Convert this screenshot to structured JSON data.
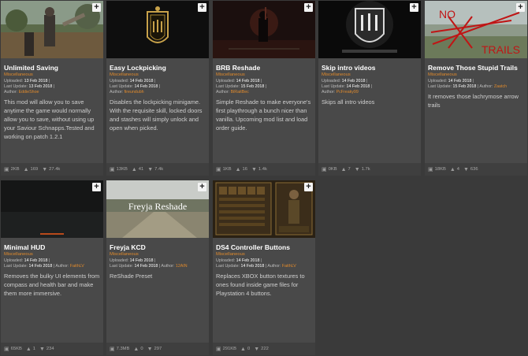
{
  "labels": {
    "uploaded": "Uploaded:",
    "last_update": "Last Update:",
    "author": "Author:",
    "add": "+"
  },
  "mods": [
    {
      "title": "Unlimited Saving",
      "category": "Miscellaneous",
      "uploaded": "13 Feb 2018",
      "last_update": "13 Feb 2018",
      "author": "EddieShoe",
      "description": "This mod will allow you to save anytime the game would normally allow you to save, without using up your Saviour Schnapps.Tested and working on patch 1.2.1",
      "size": "2KB",
      "endorsements": "169",
      "downloads": "27.4k"
    },
    {
      "title": "Easy Lockpicking",
      "category": "Miscellaneous",
      "uploaded": "14 Feb 2018",
      "last_update": "14 Feb 2018",
      "author": "fireundubh",
      "description": "Disables the lockpicking minigame. With the requisite skill, locked doors and stashes will simply unlock and open when picked.",
      "size": "13KB",
      "endorsements": "41",
      "downloads": "7.4k"
    },
    {
      "title": "BRB Reshade",
      "category": "Miscellaneous",
      "uploaded": "14 Feb 2018",
      "last_update": "15 Feb 2018",
      "author": "BiRaitBec",
      "description": "Simple Reshade to make everyone's first playthrough a bunch nicer than vanilla. Upcoming mod list and load order guide.",
      "size": "1KB",
      "endorsements": "16",
      "downloads": "1.4k"
    },
    {
      "title": "Skip intro videos",
      "category": "Miscellaneous",
      "uploaded": "14 Feb 2018",
      "last_update": "14 Feb 2018",
      "author": "PcFreaky99",
      "description": "Skips all intro videos",
      "size": "0KB",
      "endorsements": "7",
      "downloads": "1.7k"
    },
    {
      "title": "Remove Those Stupid Trails",
      "category": "Miscellaneous",
      "uploaded": "14 Feb 2018",
      "last_update": "15 Feb 2018",
      "author": "Zaatch",
      "description": "It removes those lachrymose arrow trails",
      "size": "18KB",
      "endorsements": "4",
      "downloads": "636"
    },
    {
      "title": "Minimal HUD",
      "category": "Miscellaneous",
      "uploaded": "14 Feb 2018",
      "last_update": "14 Feb 2018",
      "author": "FaithLV",
      "description": "Removes the bulky UI elements from compass and health bar and make them more immersive.",
      "size": "65KB",
      "endorsements": "1",
      "downloads": "234"
    },
    {
      "title": "Freyja KCD",
      "category": "Miscellaneous",
      "uploaded": "14 Feb 2018",
      "last_update": "14 Feb 2018",
      "author": "12AIN",
      "description": "ReShade Preset",
      "size": "7.3MB",
      "endorsements": "0",
      "downloads": "297"
    },
    {
      "title": "DS4 Controller Buttons",
      "category": "Miscellaneous",
      "uploaded": "14 Feb 2018",
      "last_update": "14 Feb 2018",
      "author": "FaithLV",
      "description": "Replaces XBOX button textures to ones found inside game files for Playstation 4 buttons.",
      "size": "291KB",
      "endorsements": "0",
      "downloads": "222"
    }
  ],
  "thumb_text": {
    "freyja": "Freyja Reshade",
    "no": "NO",
    "trails": "TRAILS"
  },
  "icons": {
    "size": "database-icon",
    "endorsements": "thumbs-up-icon",
    "downloads": "download-icon",
    "add": "plus-icon"
  }
}
